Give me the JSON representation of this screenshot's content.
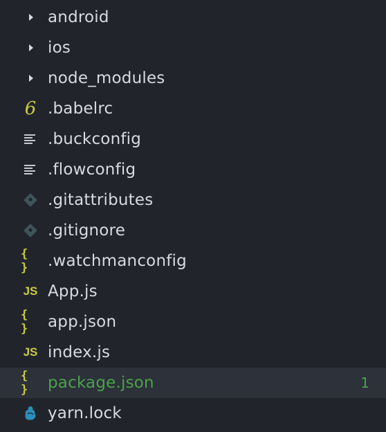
{
  "file_tree": {
    "items": [
      {
        "label": "android",
        "icon": "folder-arrow-icon",
        "kind": "folder"
      },
      {
        "label": "ios",
        "icon": "folder-arrow-icon",
        "kind": "folder"
      },
      {
        "label": "node_modules",
        "icon": "folder-arrow-icon",
        "kind": "folder"
      },
      {
        "label": ".babelrc",
        "icon": "babel-icon",
        "glyph": "6",
        "kind": "file"
      },
      {
        "label": ".buckconfig",
        "icon": "config-lines-icon",
        "kind": "file"
      },
      {
        "label": ".flowconfig",
        "icon": "config-lines-icon",
        "kind": "file"
      },
      {
        "label": ".gitattributes",
        "icon": "git-icon",
        "kind": "file"
      },
      {
        "label": ".gitignore",
        "icon": "git-icon",
        "kind": "file"
      },
      {
        "label": ".watchmanconfig",
        "icon": "json-icon",
        "glyph": "{ }",
        "kind": "file"
      },
      {
        "label": "App.js",
        "icon": "js-icon",
        "glyph": "JS",
        "kind": "file"
      },
      {
        "label": "app.json",
        "icon": "json-icon",
        "glyph": "{ }",
        "kind": "file"
      },
      {
        "label": "index.js",
        "icon": "js-icon",
        "glyph": "JS",
        "kind": "file"
      },
      {
        "label": "package.json",
        "icon": "json-icon",
        "glyph": "{ }",
        "kind": "file",
        "selected": true,
        "modified": true,
        "badge": "1"
      },
      {
        "label": "yarn.lock",
        "icon": "yarn-icon",
        "kind": "file"
      }
    ]
  },
  "colors": {
    "background": "#21252b",
    "selected_row": "#2c313a",
    "text": "#d7dae0",
    "modified": "#4ca24a",
    "icon_yellow": "#cbcb41",
    "git_icon": "#41535b",
    "yarn_icon": "#2c8ebb"
  }
}
